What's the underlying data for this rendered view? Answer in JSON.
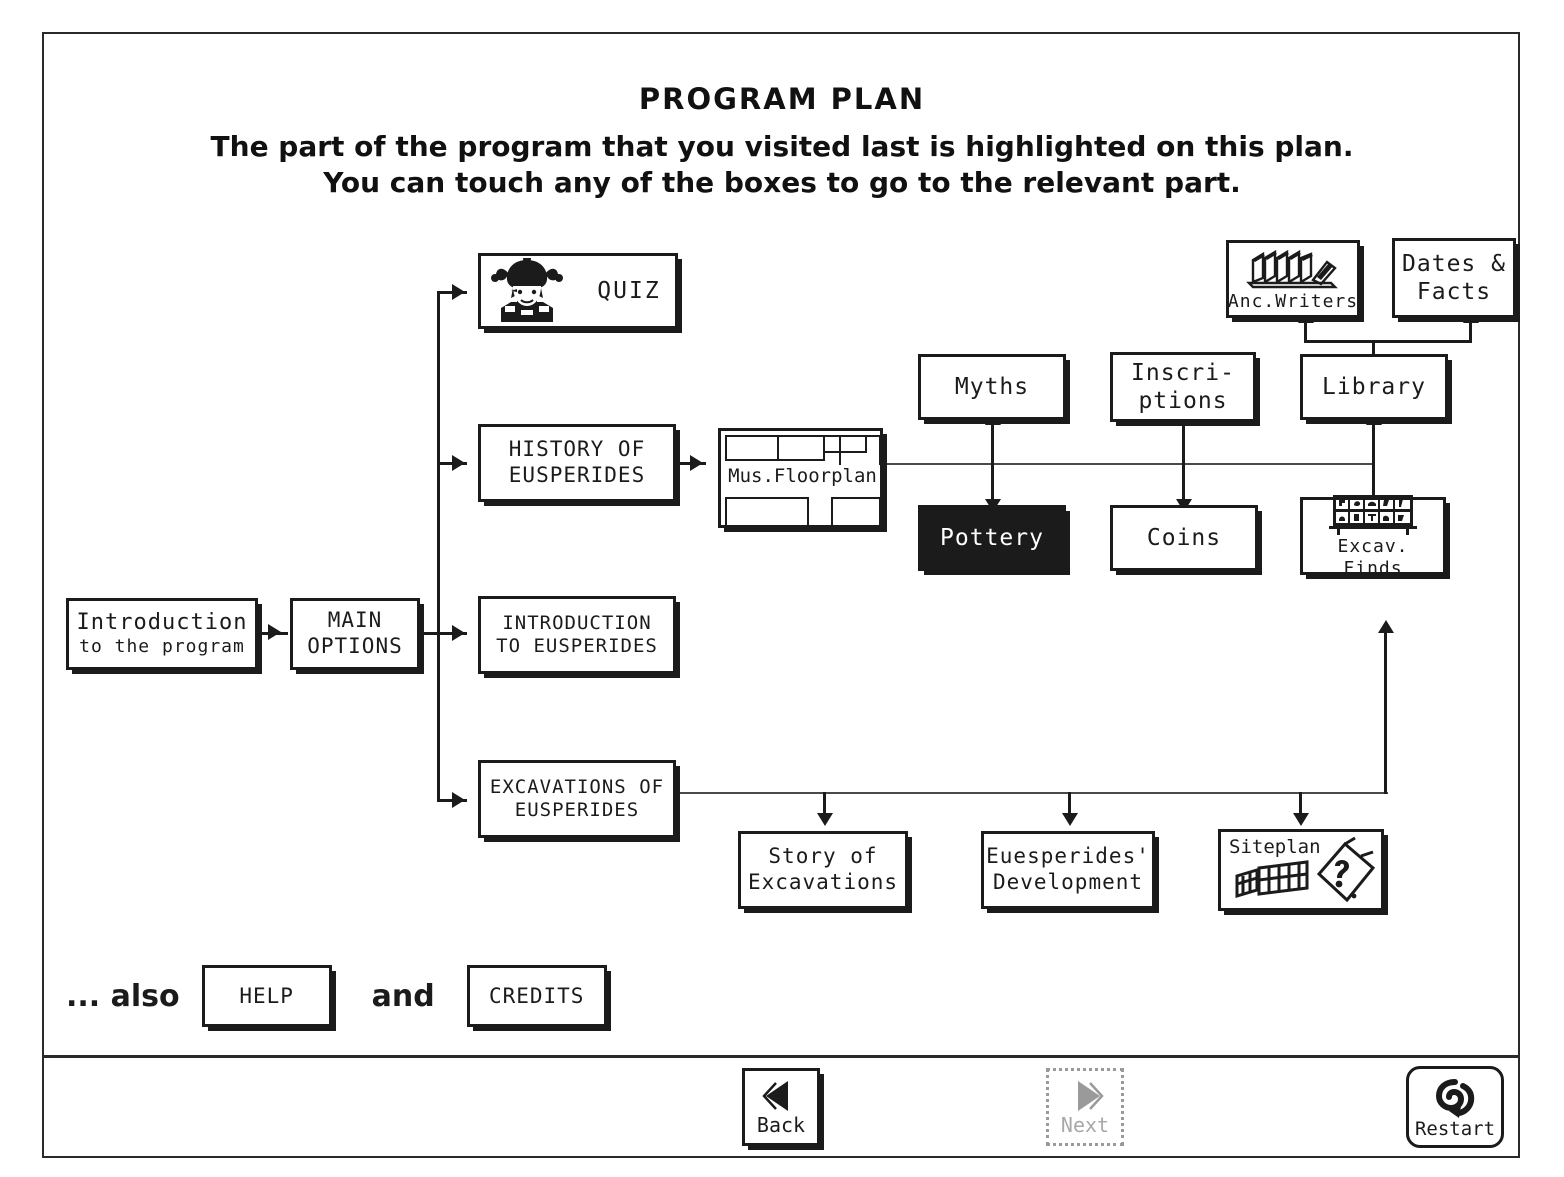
{
  "page": {
    "title": "PROGRAM PLAN",
    "subtitle_line1": "The part of the program that you visited last is highlighted on this plan.",
    "subtitle_line2": "You can touch any of the boxes to go to the relevant part."
  },
  "colors": {
    "ink": "#1b1b1b",
    "paper": "#ffffff",
    "highlight_fill": "#1b1b1b",
    "highlight_text": "#ffffff",
    "disabled": "#a8a8a8"
  },
  "nodes": {
    "introduction": {
      "line1": "Introduction",
      "line2": "to the program"
    },
    "main_options": {
      "line1": "MAIN",
      "line2": "OPTIONS"
    },
    "quiz": {
      "label": "QUIZ",
      "icon": "jester-icon"
    },
    "history": {
      "line1": "HISTORY OF",
      "line2": "EUSPERIDES"
    },
    "intro_eusperides": {
      "line1": "INTRODUCTION",
      "line2": "TO EUSPERIDES"
    },
    "excavations": {
      "line1": "EXCAVATIONS OF",
      "line2": "EUSPERIDES"
    },
    "floorplan": {
      "label": "Mus.Floorplan",
      "icon": "museum-floorplan-icon"
    },
    "myths": {
      "label": "Myths"
    },
    "inscriptions": {
      "line1": "Inscri-",
      "line2": "ptions"
    },
    "library": {
      "label": "Library"
    },
    "pottery": {
      "label": "Pottery",
      "highlighted": true
    },
    "coins": {
      "label": "Coins"
    },
    "excav_finds": {
      "label": "Excav. Finds",
      "icon": "display-shelf-icon"
    },
    "anc_writers": {
      "label": "Anc.Writers",
      "icon": "books-icon"
    },
    "dates_facts": {
      "line1": "Dates &",
      "line2": "Facts"
    },
    "story_of_excavations": {
      "line1": "Story of",
      "line2": "Excavations"
    },
    "eusperides_development": {
      "line1": "Euesperides'",
      "line2": "Development"
    },
    "siteplan": {
      "label": "Siteplan",
      "icon": "siteplan-icon"
    }
  },
  "also": {
    "prefix": "... also",
    "help_label": "HELP",
    "conjunction": "and",
    "credits_label": "CREDITS"
  },
  "footer": {
    "back_label": "Back",
    "back_icon": "triangle-left-icon",
    "next_label": "Next",
    "next_icon": "triangle-right-icon",
    "next_disabled": true,
    "restart_label": "Restart",
    "restart_icon": "spiral-arrow-icon"
  }
}
